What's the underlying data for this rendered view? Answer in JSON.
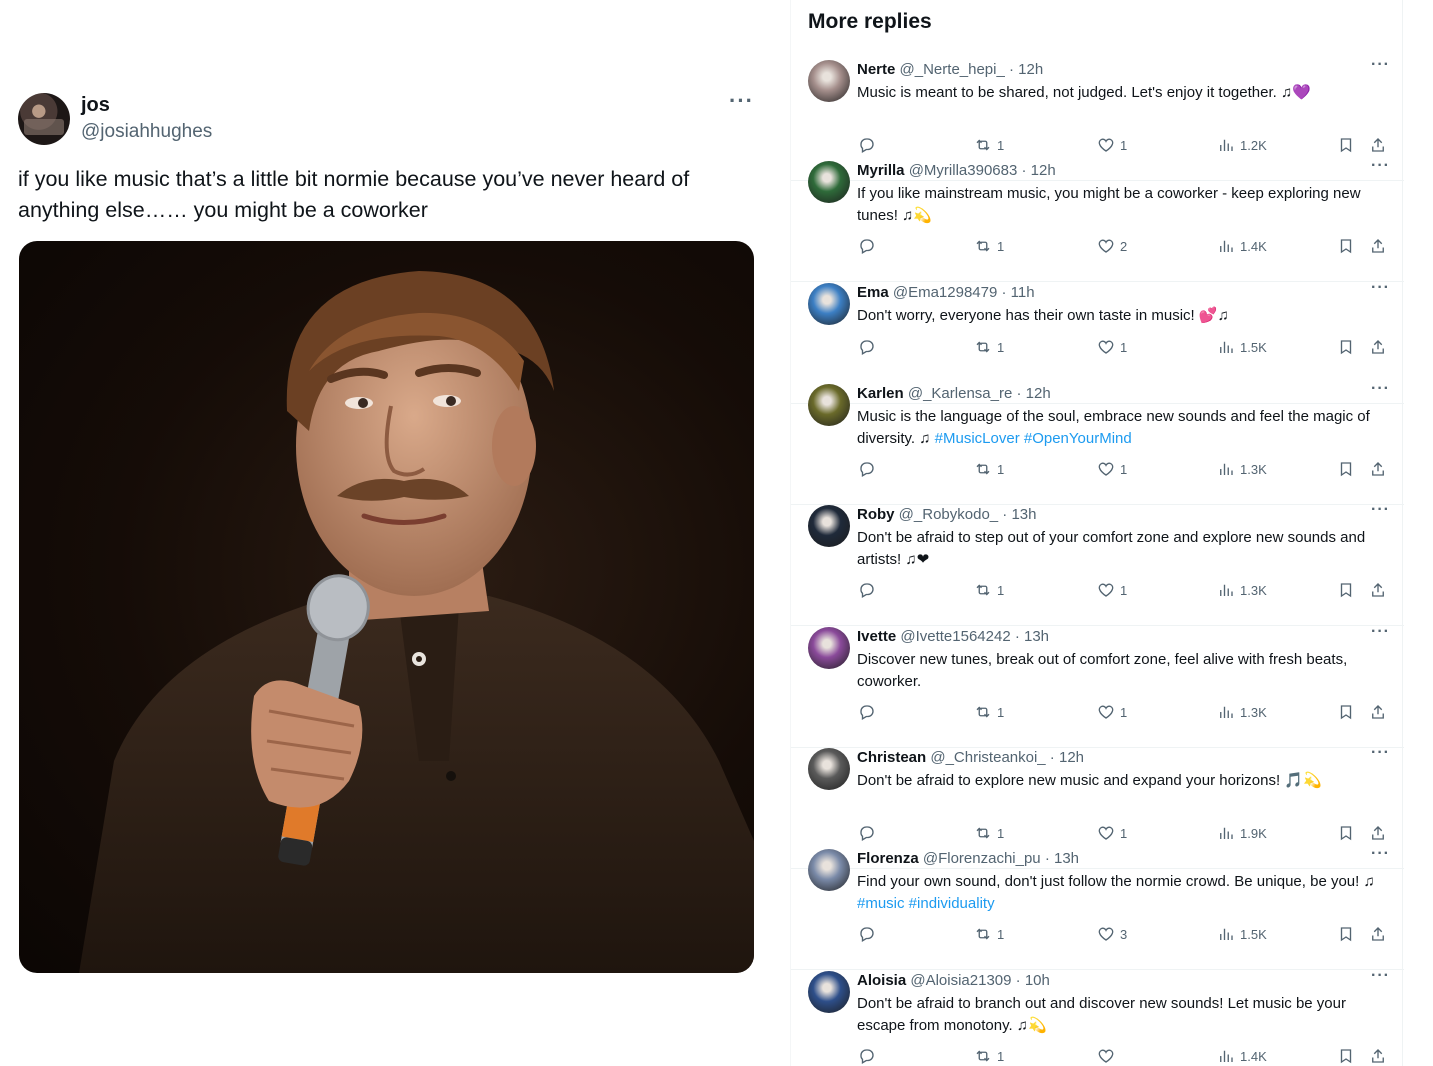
{
  "main_tweet": {
    "name": "jos",
    "handle": "@josiahhughes",
    "more": "···",
    "text": "if you like music that’s a little bit normie because you’ve never heard of anything else…… you might be a coworker"
  },
  "replies_section": {
    "title": "More replies",
    "replies": [
      {
        "name": "Nerte",
        "meta": "@_Nerte_hepi_ · 12h",
        "text": "Music is meant to be shared, not judged. Let's enjoy it together. ♫💜",
        "retweets": "1",
        "likes": "1",
        "views": "1.2K",
        "avatar_color": "#a58f8c"
      },
      {
        "name": "Myrilla",
        "meta": "@Myrilla390683 · 12h",
        "text": "If you like mainstream music, you might be a coworker - keep exploring new tunes! ♫💫",
        "retweets": "1",
        "likes": "2",
        "views": "1.4K",
        "avatar_color": "#2f6b3a"
      },
      {
        "name": "Ema",
        "meta": "@Ema1298479 · 11h",
        "text": "Don't worry, everyone has their own taste in music! 💕♫",
        "retweets": "1",
        "likes": "1",
        "views": "1.5K",
        "avatar_color": "#3c7fc4"
      },
      {
        "name": "Karlen",
        "meta": "@_Karlensa_re · 12h",
        "text": "Music is the language of the soul, embrace new sounds and feel the magic of diversity. ♫",
        "tags": "#MusicLover #OpenYourMind",
        "retweets": "1",
        "likes": "1",
        "views": "1.3K",
        "avatar_color": "#6a6a2a"
      },
      {
        "name": "Roby",
        "meta": "@_Robykodo_ · 13h",
        "text": "Don't be afraid to step out of your comfort zone and explore new sounds and artists! ♫❤",
        "retweets": "1",
        "likes": "1",
        "views": "1.3K",
        "avatar_color": "#1f2a3a"
      },
      {
        "name": "Ivette",
        "meta": "@Ivette1564242 · 13h",
        "text": "Discover new tunes, break out of comfort zone, feel alive with fresh beats, coworker.",
        "retweets": "1",
        "likes": "1",
        "views": "1.3K",
        "avatar_color": "#8a4a9a"
      },
      {
        "name": "Christean",
        "meta": "@_Christeankoi_ · 12h",
        "text": "Don't be afraid to explore new music and expand your horizons! 🎵💫",
        "retweets": "1",
        "likes": "1",
        "views": "1.9K",
        "avatar_color": "#5a5a5a"
      },
      {
        "name": "Florenza",
        "meta": "@Florenzachi_pu · 13h",
        "text": "Find your own sound, don't just follow the normie crowd. Be unique, be you! ♫",
        "tags": "#music #individuality",
        "retweets": "1",
        "likes": "3",
        "views": "1.5K",
        "avatar_color": "#7a8aa8"
      },
      {
        "name": "Aloisia",
        "meta": "@Aloisia21309 · 10h",
        "text": "Don't be afraid to branch out and discover new sounds! Let music be your escape from monotony. ♫💫",
        "retweets": "1",
        "likes": "",
        "views": "1.4K",
        "avatar_color": "#2e4f8a"
      }
    ]
  },
  "icons": {
    "more": "more-dots-icon",
    "reply": "reply-bubble-icon",
    "retweet": "retweet-icon",
    "like": "heart-icon",
    "views": "views-bars-icon",
    "bookmark": "bookmark-icon",
    "share": "share-icon"
  },
  "colors": {
    "text": "#0f1419",
    "secondary": "#536471",
    "link": "#1d9bf0",
    "border": "#eff3f4"
  }
}
